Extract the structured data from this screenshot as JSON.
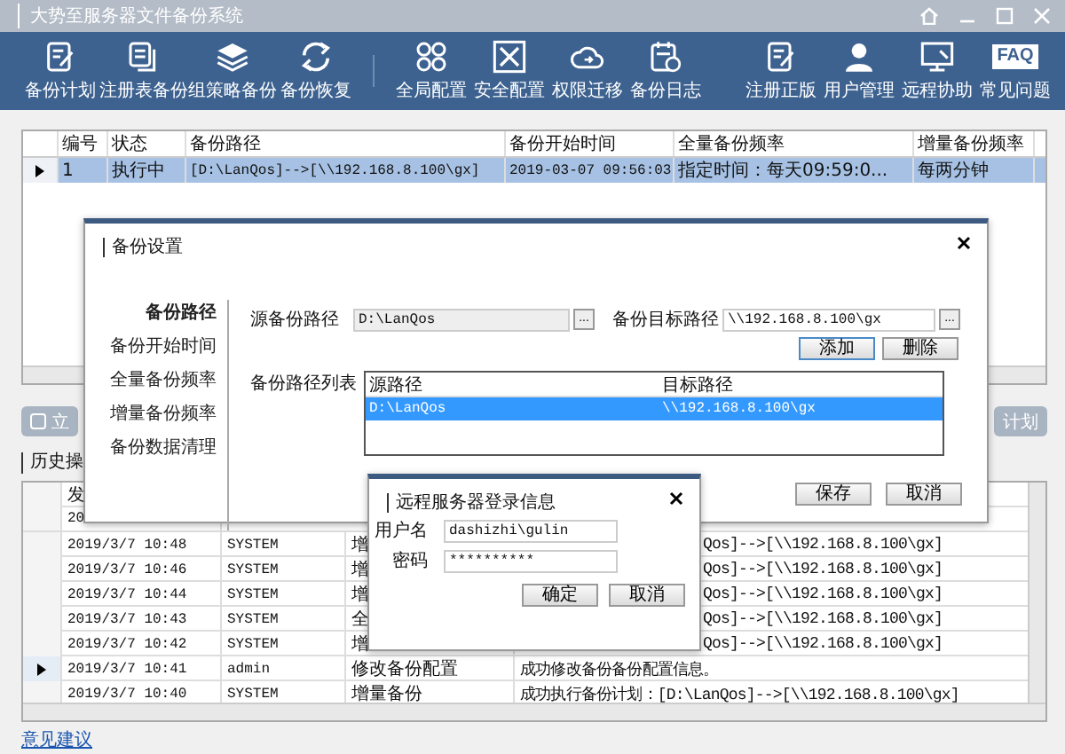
{
  "window": {
    "title": "大势至服务器文件备份系统"
  },
  "toolbar": {
    "groups": [
      [
        {
          "label": "备份计划"
        },
        {
          "label": "注册表备份"
        },
        {
          "label": "组策略备份"
        },
        {
          "label": "备份恢复"
        }
      ],
      [
        {
          "label": "全局配置"
        },
        {
          "label": "安全配置"
        },
        {
          "label": "权限迁移"
        },
        {
          "label": "备份日志"
        }
      ],
      [
        {
          "label": "注册正版"
        },
        {
          "label": "用户管理"
        },
        {
          "label": "远程协助"
        },
        {
          "label": "常见问题",
          "icon_text": "FAQ"
        }
      ]
    ]
  },
  "task_table": {
    "columns": [
      "编号",
      "状态",
      "备份路径",
      "备份开始时间",
      "全量备份频率",
      "增量备份频率"
    ],
    "rows": [
      {
        "selected": true,
        "cells": [
          "1",
          "执行中",
          "[D:\\LanQos]-->[\\\\192.168.8.100\\gx]",
          "2019-03-07 09:56:03",
          "指定时间：每天09:59:0...",
          "每两分钟"
        ]
      }
    ]
  },
  "action_buttons": [
    "立",
    "计划"
  ],
  "history": {
    "title": "历史操",
    "columns": [
      "发"
    ],
    "rows": [
      {
        "selected": false,
        "kind": "hidden",
        "cells": [
          "20"
        ]
      },
      {
        "selected": false,
        "kind": "covered",
        "cells": [
          "2019/3/7 10:48",
          "SYSTEM",
          "增",
          "Qos]-->[\\\\192.168.8.100\\gx]"
        ]
      },
      {
        "selected": false,
        "kind": "covered",
        "cells": [
          "2019/3/7 10:46",
          "SYSTEM",
          "增",
          "Qos]-->[\\\\192.168.8.100\\gx]"
        ]
      },
      {
        "selected": false,
        "kind": "covered",
        "cells": [
          "2019/3/7 10:44",
          "SYSTEM",
          "增",
          "Qos]-->[\\\\192.168.8.100\\gx]"
        ]
      },
      {
        "selected": false,
        "kind": "covered",
        "cells": [
          "2019/3/7 10:43",
          "SYSTEM",
          "全",
          "Qos]-->[\\\\192.168.8.100\\gx]"
        ]
      },
      {
        "selected": false,
        "kind": "covered",
        "cells": [
          "2019/3/7 10:42",
          "SYSTEM",
          "增",
          "Qos]-->[\\\\192.168.8.100\\gx]"
        ]
      },
      {
        "selected": true,
        "kind": "full",
        "cells": [
          "2019/3/7 10:41",
          "admin",
          "修改备份配置",
          "成功修改备份备份配置信息。"
        ]
      },
      {
        "selected": false,
        "kind": "full",
        "cells": [
          "2019/3/7 10:40",
          "SYSTEM",
          "增量备份",
          "成功执行备份计划：[D:\\LanQos]-->[\\\\192.168.8.100\\gx]"
        ]
      }
    ]
  },
  "feedback_link": "意见建议",
  "backup_dialog": {
    "title": "备份设置",
    "nav": [
      {
        "label": "备份路径",
        "selected": true
      },
      {
        "label": "备份开始时间",
        "selected": false
      },
      {
        "label": "全量备份频率",
        "selected": false
      },
      {
        "label": "增量备份频率",
        "selected": false
      },
      {
        "label": "备份数据清理",
        "selected": false
      }
    ],
    "source_label": "源备份路径",
    "source_value": "D:\\LanQos",
    "source_browse": "...",
    "target_label": "备份目标路径",
    "target_value": "\\\\192.168.8.100\\gx",
    "target_browse": "...",
    "add": "添加",
    "delete": "删除",
    "list_label": "备份路径列表",
    "list_columns": [
      "源路径",
      "目标路径"
    ],
    "list_rows": [
      {
        "selected": true,
        "cells": [
          "D:\\LanQos",
          "\\\\192.168.8.100\\gx"
        ]
      }
    ],
    "save": "保存",
    "cancel": "取消"
  },
  "login_dialog": {
    "title": "远程服务器登录信息",
    "username_label": "用户名",
    "username": "dashizhi\\gulin",
    "password_label": "密码",
    "password": "**********",
    "ok": "确定",
    "cancel": "取消"
  }
}
